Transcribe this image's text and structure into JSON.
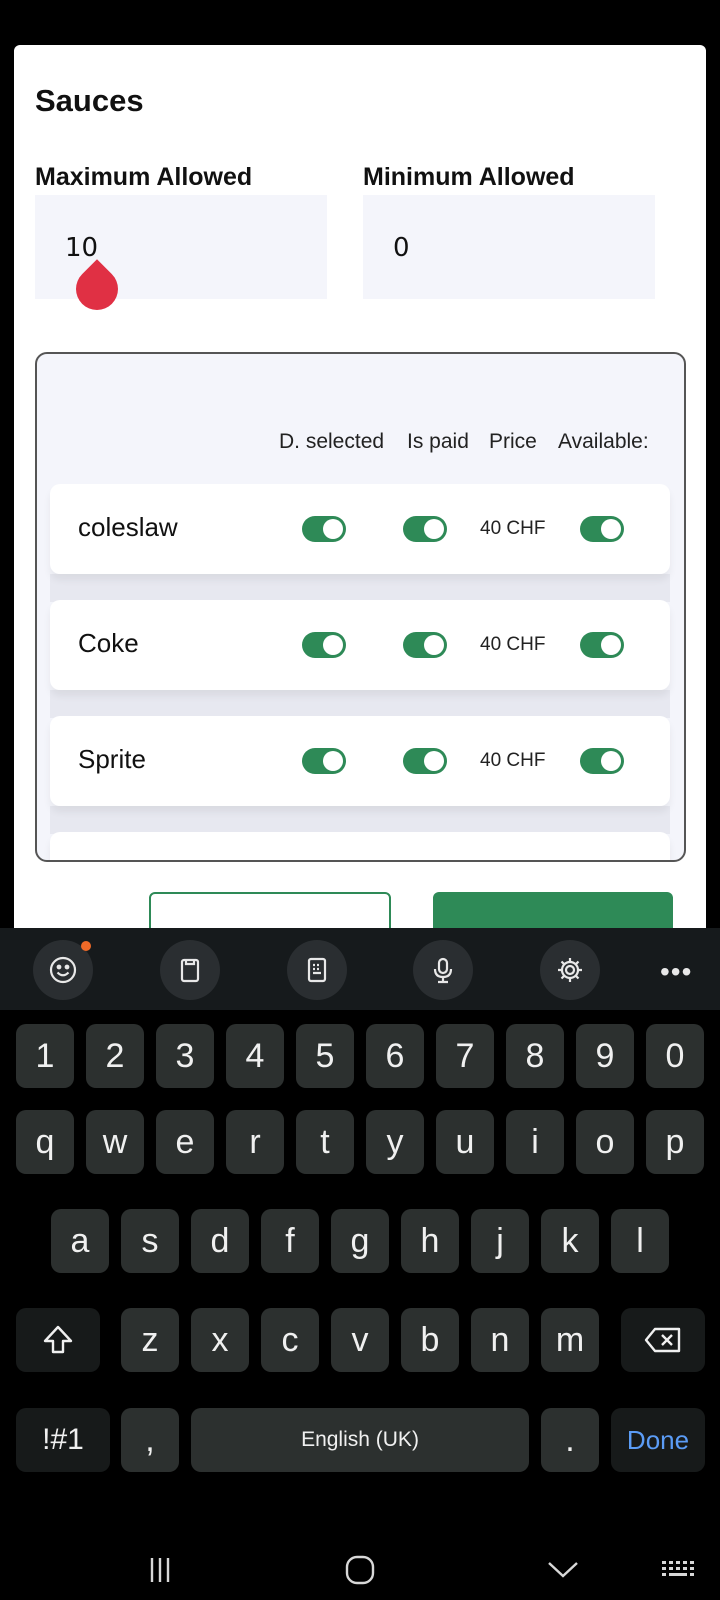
{
  "dialog": {
    "title": "Sauces",
    "max_label": "Maximum Allowed",
    "max_value": "10",
    "min_label": "Minimum Allowed",
    "min_value": "0"
  },
  "options": {
    "headers": {
      "default_selected": "D. selected",
      "is_paid": "Is paid",
      "price": "Price",
      "available": "Available:"
    },
    "rows": [
      {
        "name": "coleslaw",
        "price": "40 CHF",
        "default_selected": true,
        "is_paid": true,
        "available": true
      },
      {
        "name": "Coke",
        "price": "40 CHF",
        "default_selected": true,
        "is_paid": true,
        "available": true
      },
      {
        "name": "Sprite",
        "price": "40 CHF",
        "default_selected": true,
        "is_paid": true,
        "available": true
      }
    ]
  },
  "keyboard": {
    "toolbar": [
      "emoji-icon",
      "clipboard-icon",
      "keypad-icon",
      "microphone-icon",
      "gear-icon",
      "more-icon"
    ],
    "numbers": [
      "1",
      "2",
      "3",
      "4",
      "5",
      "6",
      "7",
      "8",
      "9",
      "0"
    ],
    "row1": [
      "q",
      "w",
      "e",
      "r",
      "t",
      "y",
      "u",
      "i",
      "o",
      "p"
    ],
    "row2": [
      "a",
      "s",
      "d",
      "f",
      "g",
      "h",
      "j",
      "k",
      "l"
    ],
    "row3": [
      "z",
      "x",
      "c",
      "v",
      "b",
      "n",
      "m"
    ],
    "symbols_label": "!#1",
    "comma_label": ",",
    "space_label": "English (UK)",
    "period_label": ".",
    "done_label": "Done"
  },
  "colors": {
    "accent": "#2e8a57",
    "caret": "#e03044",
    "done": "#5b9cf6"
  }
}
